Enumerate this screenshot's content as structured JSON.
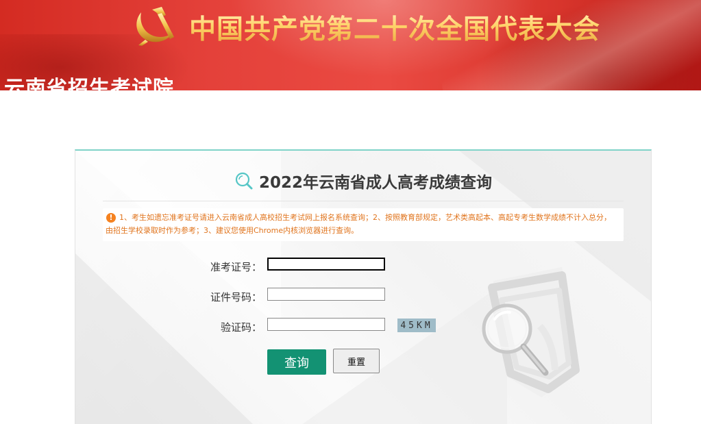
{
  "banner": {
    "title": "中国共产党第二十次全国代表大会",
    "site_name": "云南省招生考试院"
  },
  "panel": {
    "title": "2022年云南省成人高考成绩查询",
    "notice_icon": "exclamation-icon",
    "notice": "1、考生如遗忘准考证号请进入云南省成人高校招生考试网上报名系统查询；2、按照教育部规定，艺术类高起本、高起专考生数学成绩不计入总分，由招生学校录取时作为参考；3、建议您使用Chrome内核浏览器进行查询。"
  },
  "form": {
    "exam_no_label": "准考证号：",
    "exam_no_value": "",
    "id_no_label": "证件号码：",
    "id_no_value": "",
    "captcha_label": "验证码：",
    "captcha_value": "",
    "captcha_image_text": "45KM",
    "query_button": "查询",
    "reset_button": "重置"
  },
  "colors": {
    "banner_red": "#e4413a",
    "banner_gold": "#ffd36a",
    "accent_teal": "#139273",
    "panel_top_border": "#7fd3c8",
    "notice_orange": "#e0741d"
  }
}
